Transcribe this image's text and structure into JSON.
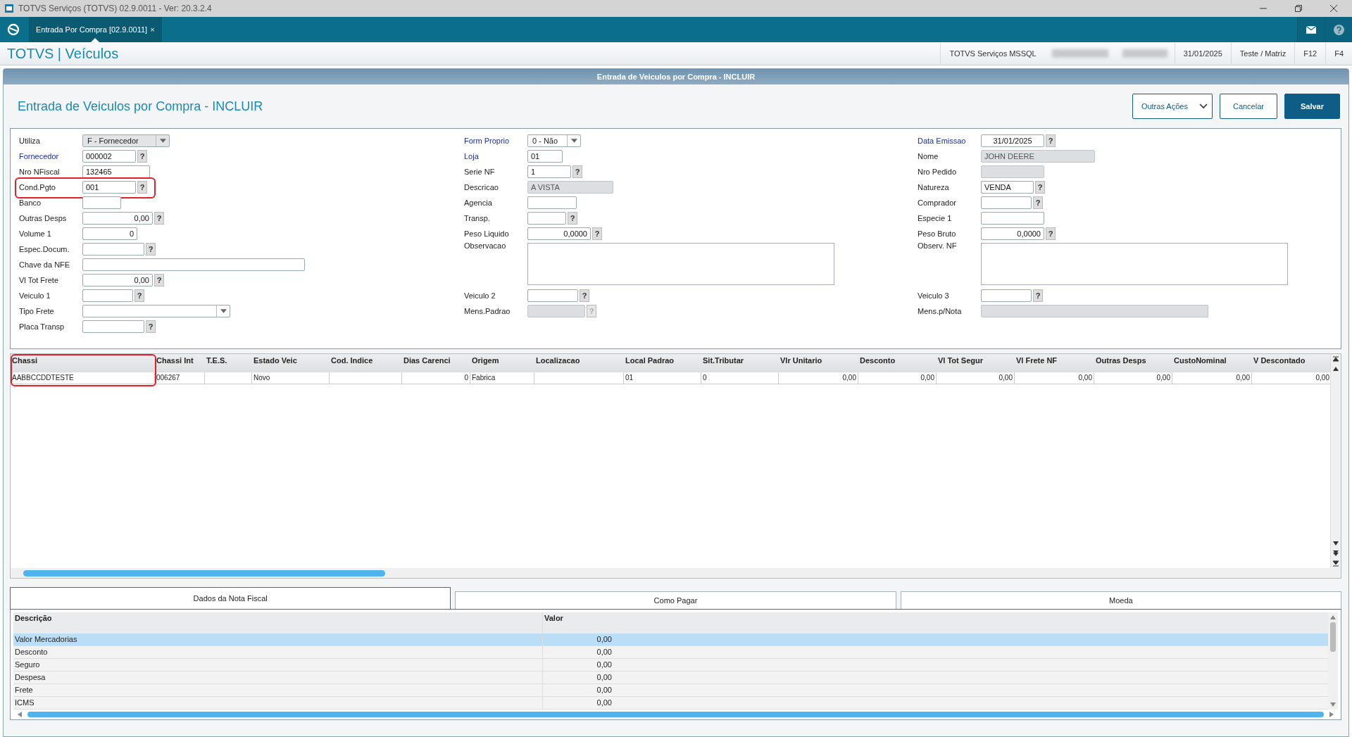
{
  "window": {
    "title": "TOTVS Serviços (TOTVS) 02.9.0011 - Ver: 20.3.2.4"
  },
  "tabs": [
    {
      "label": "Entrada Por Compra [02.9.0011]",
      "close": "×",
      "selected": true
    }
  ],
  "header": {
    "brand": "TOTVS | Veículos",
    "status": [
      "TOTVS Serviços MSSQL",
      "31/01/2025",
      "Teste / Matriz",
      "F12",
      "F4"
    ]
  },
  "panel": {
    "caption": "Entrada de Veiculos por Compra - INCLUIR",
    "title": "Entrada de Veiculos por Compra - INCLUIR",
    "buttons": [
      {
        "label": "Outras Ações",
        "kind": "menu"
      },
      {
        "label": "Cancelar",
        "kind": "plain"
      },
      {
        "label": "Salvar",
        "kind": "primary"
      }
    ]
  },
  "form": {
    "columns": [
      [
        {
          "label": "Utiliza",
          "kind": "select",
          "value": "F - Fornecedor",
          "required": false,
          "readonly": false
        },
        {
          "label": "Fornecedor",
          "kind": "text",
          "value": "000002",
          "required": true,
          "readonly": false,
          "help": {
            "label": "?",
            "disabled": false
          }
        },
        {
          "label": "Nro NFiscal",
          "kind": "text",
          "value": "132465",
          "required": false,
          "readonly": false
        },
        {
          "label": "Cond.Pgto",
          "kind": "text",
          "value": "001",
          "required": false,
          "readonly": false,
          "highlighted": true,
          "help": {
            "label": "?",
            "disabled": false
          }
        },
        {
          "label": "Banco",
          "kind": "text",
          "required": false,
          "readonly": false
        },
        {
          "label": "Outras Desps",
          "kind": "number",
          "value": "0,00",
          "required": false,
          "readonly": false,
          "help": {
            "label": "?",
            "disabled": false
          }
        },
        {
          "label": "Volume 1",
          "kind": "number",
          "value": "0",
          "required": false,
          "readonly": false
        },
        {
          "label": "Espec.Docum.",
          "kind": "text",
          "required": false,
          "readonly": false,
          "help": {
            "label": "?",
            "disabled": false
          }
        },
        {
          "label": "Chave da NFE",
          "kind": "text",
          "required": false,
          "readonly": false
        },
        {
          "label": "Vl Tot Frete",
          "kind": "number",
          "value": "0,00",
          "required": false,
          "readonly": false,
          "help": {
            "label": "?",
            "disabled": false
          }
        },
        {
          "label": "Veiculo 1",
          "kind": "text",
          "required": false,
          "readonly": false,
          "help": {
            "label": "?",
            "disabled": false
          }
        },
        {
          "label": "Tipo Frete",
          "kind": "select",
          "required": false,
          "readonly": false
        },
        {
          "label": "Placa Transp",
          "kind": "text",
          "required": false,
          "readonly": false,
          "help": {
            "label": "?",
            "disabled": false
          }
        }
      ],
      [
        {
          "label": "Form Proprio",
          "kind": "select",
          "value": "0 - Não",
          "required": true,
          "readonly": false
        },
        {
          "label": "Loja",
          "kind": "text",
          "value": "01",
          "required": true,
          "readonly": false
        },
        {
          "label": "Serie NF",
          "kind": "text",
          "value": "1",
          "required": false,
          "readonly": false,
          "help": {
            "label": "?",
            "disabled": false
          }
        },
        {
          "label": "Descricao",
          "kind": "text",
          "value": "A VISTA",
          "required": false,
          "readonly": true
        },
        {
          "label": "Agencia",
          "kind": "text",
          "required": false,
          "readonly": false
        },
        {
          "label": "Transp.",
          "kind": "text",
          "required": false,
          "readonly": false,
          "help": {
            "label": "?",
            "disabled": false
          }
        },
        {
          "label": "Peso Liquido",
          "kind": "number",
          "value": "0,0000",
          "required": false,
          "readonly": false,
          "help": {
            "label": "?",
            "disabled": false
          }
        },
        {
          "label": "Observacao",
          "kind": "memo",
          "required": false,
          "readonly": false
        },
        {
          "label": "Veiculo 2",
          "kind": "text",
          "required": false,
          "readonly": false,
          "help": {
            "label": "?",
            "disabled": false
          }
        },
        {
          "label": "Mens.Padrao",
          "kind": "text",
          "required": false,
          "readonly": true,
          "help": {
            "label": "?",
            "disabled": true
          }
        }
      ],
      [
        {
          "label": "Data Emissao",
          "kind": "date",
          "value": "31/01/2025",
          "required": true,
          "readonly": false,
          "help": {
            "label": "?",
            "disabled": false
          }
        },
        {
          "label": "Nome",
          "kind": "text",
          "value": "JOHN DEERE",
          "required": false,
          "readonly": true
        },
        {
          "label": "Nro Pedido",
          "kind": "text",
          "required": false,
          "readonly": true
        },
        {
          "label": "Natureza",
          "kind": "text",
          "value": "VENDA",
          "required": false,
          "readonly": false,
          "help": {
            "label": "?",
            "disabled": false
          }
        },
        {
          "label": "Comprador",
          "kind": "text",
          "required": false,
          "readonly": false,
          "help": {
            "label": "?",
            "disabled": false
          }
        },
        {
          "label": "Especie 1",
          "kind": "text",
          "required": false,
          "readonly": false
        },
        {
          "label": "Peso Bruto",
          "kind": "number",
          "value": "0,0000",
          "required": false,
          "readonly": false,
          "help": {
            "label": "?",
            "disabled": false
          }
        },
        {
          "label": "Observ. NF",
          "kind": "memo",
          "required": false,
          "readonly": false
        },
        {
          "label": "Veiculo 3",
          "kind": "text",
          "required": false,
          "readonly": false,
          "help": {
            "label": "?",
            "disabled": false
          }
        },
        {
          "label": "Mens.p/Nota",
          "kind": "text",
          "required": false,
          "readonly": true
        }
      ]
    ]
  },
  "grid": {
    "columns": [
      {
        "label": "Chassi",
        "highlighted": true
      },
      {
        "label": "Chassi Int"
      },
      {
        "label": "T.E.S."
      },
      {
        "label": "Estado Veic"
      },
      {
        "label": "Cod. Indice"
      },
      {
        "label": "Dias Carenci"
      },
      {
        "label": "Origem"
      },
      {
        "label": "Localizacao"
      },
      {
        "label": "Local Padrao"
      },
      {
        "label": "Sit.Tributar"
      },
      {
        "label": "Vlr Unitario"
      },
      {
        "label": "Desconto"
      },
      {
        "label": "Vl Tot Segur"
      },
      {
        "label": "Vl Frete NF"
      },
      {
        "label": "Outras Desps"
      },
      {
        "label": "CustoNominal"
      },
      {
        "label": "V Descontado"
      }
    ],
    "rows": [
      [
        "AABBCCDDTESTE",
        "006267",
        "",
        "Novo",
        "",
        "0",
        "Fabrica",
        "",
        "01",
        "0",
        "0,00",
        "0,00",
        "0,00",
        "0,00",
        "0,00",
        "0,00",
        "0,00"
      ]
    ]
  },
  "bottom_tabs": [
    {
      "label": "Dados da Nota Fiscal",
      "selected": true
    },
    {
      "label": "Como Pagar",
      "selected": false
    },
    {
      "label": "Moeda",
      "selected": false
    }
  ],
  "totals": {
    "columns": [
      "Descrição",
      "Valor"
    ],
    "rows": [
      {
        "cells": [
          "Valor Mercadorias",
          "0,00"
        ],
        "selected": true
      },
      {
        "cells": [
          "Desconto",
          "0,00"
        ],
        "selected": false
      },
      {
        "cells": [
          "Seguro",
          "0,00"
        ],
        "selected": false
      },
      {
        "cells": [
          "Despesa",
          "0,00"
        ],
        "selected": false
      },
      {
        "cells": [
          "Frete",
          "0,00"
        ],
        "selected": false
      },
      {
        "cells": [
          "ICMS",
          "0,00"
        ],
        "selected": false
      }
    ]
  }
}
